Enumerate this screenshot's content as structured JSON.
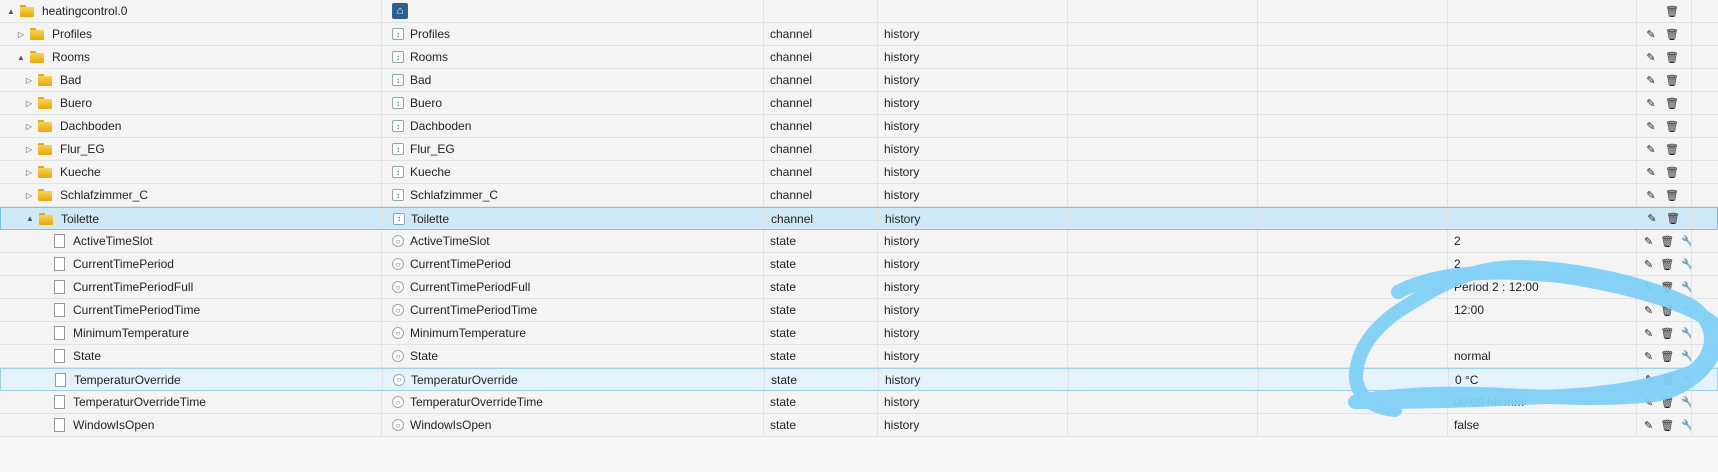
{
  "tree": {
    "root": {
      "label": "heatingcontrol.0"
    },
    "rows": [
      {
        "label": "Profiles",
        "name": "Profiles",
        "type": "channel",
        "role": "history",
        "value": ""
      },
      {
        "label": "Rooms",
        "name": "Rooms",
        "type": "channel",
        "role": "history",
        "value": ""
      },
      {
        "label": "Bad",
        "name": "Bad",
        "type": "channel",
        "role": "history",
        "value": ""
      },
      {
        "label": "Buero",
        "name": "Buero",
        "type": "channel",
        "role": "history",
        "value": ""
      },
      {
        "label": "Dachboden",
        "name": "Dachboden",
        "type": "channel",
        "role": "history",
        "value": ""
      },
      {
        "label": "Flur_EG",
        "name": "Flur_EG",
        "type": "channel",
        "role": "history",
        "value": ""
      },
      {
        "label": "Kueche",
        "name": "Kueche",
        "type": "channel",
        "role": "history",
        "value": ""
      },
      {
        "label": "Schlafzimmer_C",
        "name": "Schlafzimmer_C",
        "type": "channel",
        "role": "history",
        "value": ""
      },
      {
        "label": "Toilette",
        "name": "Toilette",
        "type": "channel",
        "role": "history",
        "value": ""
      },
      {
        "label": "ActiveTimeSlot",
        "name": "ActiveTimeSlot",
        "type": "state",
        "role": "history",
        "value": "2"
      },
      {
        "label": "CurrentTimePeriod",
        "name": "CurrentTimePeriod",
        "type": "state",
        "role": "history",
        "value": "2"
      },
      {
        "label": "CurrentTimePeriodFull",
        "name": "CurrentTimePeriodFull",
        "type": "state",
        "role": "history",
        "value": "Period 2 : 12:00"
      },
      {
        "label": "CurrentTimePeriodTime",
        "name": "CurrentTimePeriodTime",
        "type": "state",
        "role": "history",
        "value": "12:00"
      },
      {
        "label": "MinimumTemperature",
        "name": "MinimumTemperature",
        "type": "state",
        "role": "history",
        "value": ""
      },
      {
        "label": "State",
        "name": "State",
        "type": "state",
        "role": "history",
        "value": "normal"
      },
      {
        "label": "TemperaturOverride",
        "name": "TemperaturOverride",
        "type": "state",
        "role": "history",
        "value": "0 °C"
      },
      {
        "label": "TemperaturOverrideTime",
        "name": "TemperaturOverrideTime",
        "type": "state",
        "role": "history",
        "value": "00:00 hh:mm"
      },
      {
        "label": "WindowIsOpen",
        "name": "WindowIsOpen",
        "type": "state",
        "role": "history",
        "value": "false"
      }
    ]
  },
  "icons": {
    "expanded": "▲",
    "collapsed": "▷",
    "edit": "✎",
    "delete": "🗑",
    "wrench": "🔧",
    "home": "⌂",
    "channel_glyph": "↕",
    "state_glyph": "○"
  },
  "colors": {
    "selected_row": "#cfe8f6",
    "highlight_stroke": "#80cff5"
  }
}
